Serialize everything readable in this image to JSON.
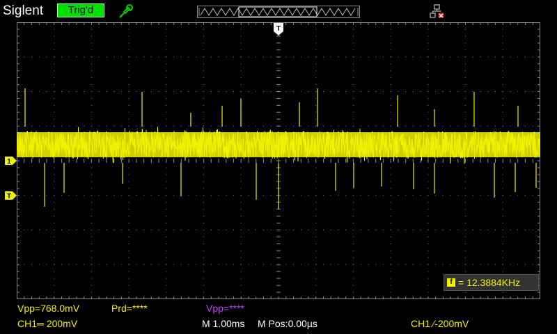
{
  "header": {
    "brand": "Siglent",
    "trigger_status": "Trig'd"
  },
  "markers": {
    "trigger_position": "T",
    "channel1": "1",
    "trigger_level": "T"
  },
  "frequency_counter": {
    "icon": "f",
    "value": "= 12.3884KHz"
  },
  "measurements": {
    "vpp_ch1": "Vpp=768.0mV",
    "prd": "Prd=****",
    "vpp_ch2": "Vpp=****"
  },
  "status": {
    "ch1_scale": "CH1═ 200mV",
    "timebase": "M 1.00ms",
    "mpos": "M Pos:0.00µs",
    "trigger": "CH1 ∕-200mV"
  },
  "colors": {
    "ch1": "#f2f200",
    "ch2": "#c040ff",
    "trig_badge": "#00e000",
    "grid": "#8a8a8a"
  }
}
